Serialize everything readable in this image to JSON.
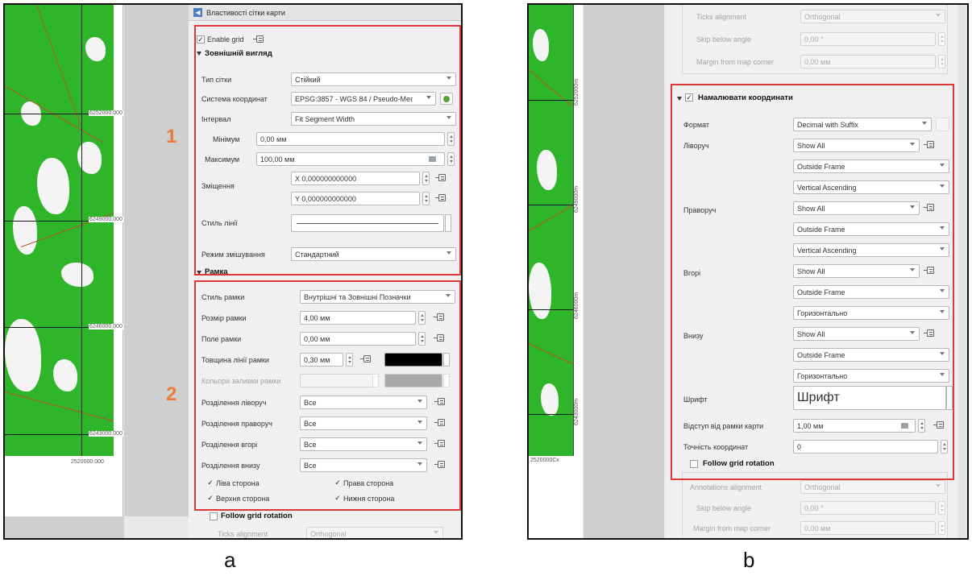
{
  "captions": {
    "a": "a",
    "b": "b"
  },
  "markers": {
    "one": "1",
    "two": "2"
  },
  "panel_a": {
    "dock_title": "Властивості сітки карти",
    "map_labels": [
      "6252000.000",
      "6249000.000",
      "6246000.000",
      "6243000.000",
      "2520000.000"
    ],
    "enable_grid": "Enable grid",
    "appearance_section": "Зовнішній вигляд",
    "grid_type": {
      "label": "Тип сітки",
      "value": "Стійкий"
    },
    "crs": {
      "label": "Система координат",
      "value": "EPSG:3857 - WGS 84 / Pseudo-Mer"
    },
    "interval": {
      "label": "Інтервал",
      "value": "Fit Segment Width"
    },
    "minimum": {
      "label": "Мінімум",
      "value": "0,00 мм"
    },
    "maximum": {
      "label": "Максимум",
      "value": "100,00 мм"
    },
    "offset": {
      "label": "Зміщення",
      "x": "X 0,000000000000",
      "y": "Y 0,000000000000"
    },
    "line_style": {
      "label": "Стиль лінії"
    },
    "blend_mode": {
      "label": "Режим змішування",
      "value": "Стандартний"
    },
    "frame_section": "Рамка",
    "frame_style": {
      "label": "Стиль рамки",
      "value": "Внутрішні та Зовнішні Позначки"
    },
    "frame_size": {
      "label": "Розмір рамки",
      "value": "4,00 мм"
    },
    "frame_margin": {
      "label": "Поле рамки",
      "value": "0,00 мм"
    },
    "frame_line_thickness": {
      "label": "Товщина лінії рамки",
      "value": "0,30 мм",
      "color": "#000000"
    },
    "frame_fill_colors": {
      "label": "Кольори заливки рамки",
      "color": "#a9a9a9"
    },
    "divisions": [
      {
        "label": "Розділення ліворуч",
        "value": "Все"
      },
      {
        "label": "Розділення праворуч",
        "value": "Все"
      },
      {
        "label": "Розділення вгорі",
        "value": "Все"
      },
      {
        "label": "Розділення внизу",
        "value": "Все"
      }
    ],
    "sides": {
      "left": "Ліва сторона",
      "right": "Права сторона",
      "top": "Верхня сторона",
      "bottom": "Нижня сторона"
    },
    "follow_grid_rotation": "Follow grid rotation",
    "ticks_alignment": {
      "label": "Ticks alignment",
      "value": "Orthogonal"
    }
  },
  "panel_b": {
    "map_labels": [
      "6252000m",
      "6249000m",
      "6246000m",
      "6243000m",
      "2520000Cx"
    ],
    "ticks_alignment": {
      "label": "Ticks alignment",
      "value": "Orthogonal"
    },
    "skip_below_angle": {
      "label": "Skip below angle",
      "value": "0,00 °"
    },
    "margin_from_corner": {
      "label": "Margin from map corner",
      "value": "0,00 мм"
    },
    "draw_coords_section": "Намалювати координати",
    "format": {
      "label": "Формат",
      "value": "Decimal with Suffix"
    },
    "left": {
      "label": "Ліворуч",
      "show": "Show All",
      "position": "Outside Frame",
      "direction": "Vertical Ascending"
    },
    "right": {
      "label": "Праворуч",
      "show": "Show All",
      "position": "Outside Frame",
      "direction": "Vertical Ascending"
    },
    "top": {
      "label": "Вгорі",
      "show": "Show All",
      "position": "Outside Frame",
      "direction": "Горизонтально"
    },
    "bottom": {
      "label": "Внизу",
      "show": "Show All",
      "position": "Outside Frame",
      "direction": "Горизонтально"
    },
    "font": {
      "label": "Шрифт",
      "value": "Шрифт"
    },
    "frame_distance": {
      "label": "Відступ від рамки карти",
      "value": "1,00 мм"
    },
    "precision": {
      "label": "Точність координат",
      "value": "0"
    },
    "follow_grid_rotation": "Follow grid rotation",
    "annotations_alignment": {
      "label": "Annotations alignment",
      "value": "Orthogonal"
    },
    "skip_below_angle_2": {
      "label": "Skip below angle",
      "value": "0,00 °"
    },
    "margin_from_corner_2": {
      "label": "Margin from map corner",
      "value": "0,00 мм"
    }
  }
}
